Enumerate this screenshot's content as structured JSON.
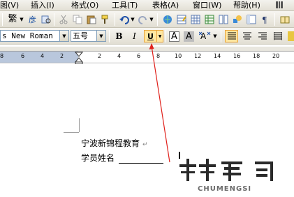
{
  "menubar": {
    "items": [
      {
        "label": "图(V)"
      },
      {
        "label": "插入(I)"
      },
      {
        "label": "格式(O)"
      },
      {
        "label": "工具(T)"
      },
      {
        "label": "表格(A)"
      },
      {
        "label": "窗口(W)"
      },
      {
        "label": "帮助(H)"
      }
    ]
  },
  "toolbar": {
    "simplified_label": "繁"
  },
  "format_toolbar": {
    "font_name": "s New Roman",
    "font_size": "五号",
    "bold_label": "B",
    "italic_label": "I",
    "underline_label": "U",
    "char_border_label": "A",
    "char_shading_label": "A"
  },
  "ruler": {
    "labels_left": [
      "8",
      "6",
      "4",
      "2"
    ],
    "labels_right": [
      "2",
      "4",
      "6",
      "8",
      "10",
      "12",
      "14",
      "16",
      "18",
      "20"
    ]
  },
  "document": {
    "line1": "宁波新锦程教育",
    "line2": "学员姓名",
    "para_mark": "↵"
  },
  "watermark": {
    "text": "CHUMENGSI"
  },
  "colors": {
    "annotation_arrow": "#e0201b",
    "highlight": "#ffe7a2"
  }
}
